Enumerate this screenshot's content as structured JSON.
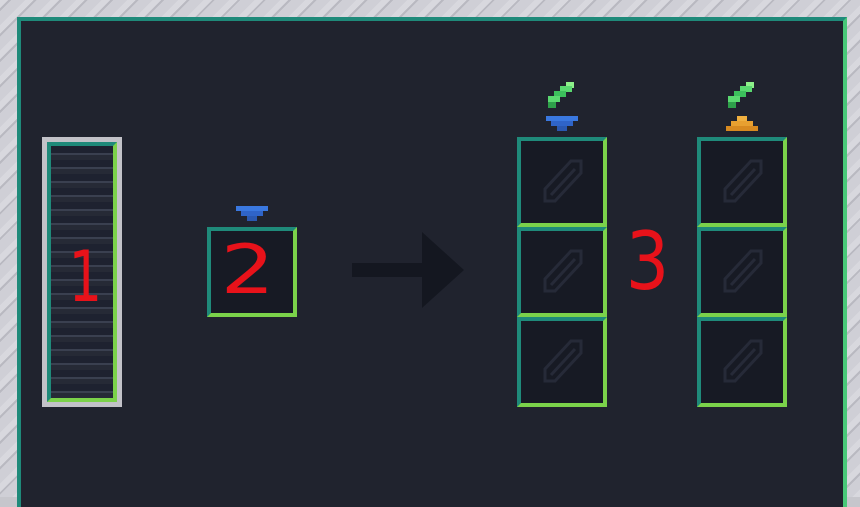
{
  "markers": {
    "one": "1",
    "two": "2",
    "three": "3"
  },
  "colors": {
    "panel_bg": "#20232e",
    "slot_bg": "#171a24",
    "border_dark": "#1f8a7a",
    "border_light": "#7bd24a",
    "marker_red": "#e8121a",
    "funnel_blue": "#3a78e0",
    "funnel_orange": "#e8a030",
    "feather_green": "#5ad870"
  },
  "icons": {
    "input_filter": "blue-funnel-icon",
    "output_a_filter": "blue-funnel-icon",
    "output_b_filter": "orange-funnel-icon",
    "output_a_item": "green-feather-icon",
    "output_b_item": "green-feather-icon",
    "direction": "right-arrow-icon"
  }
}
